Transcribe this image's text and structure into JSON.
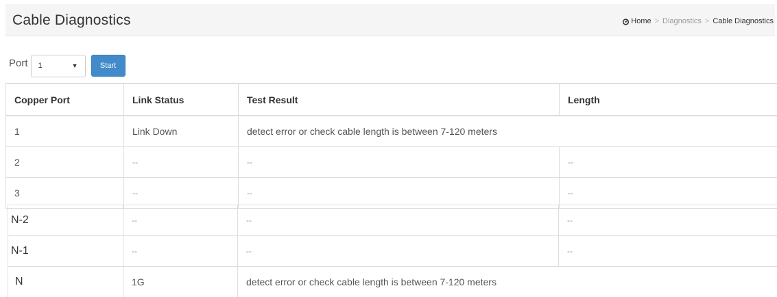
{
  "header": {
    "title": "Cable Diagnostics",
    "breadcrumb": {
      "home": "Home",
      "section": "Diagnostics",
      "current": "Cable Diagnostics",
      "separator": ">"
    }
  },
  "toolbar": {
    "port_label": "Port",
    "port_value": "1",
    "start_label": "Start"
  },
  "table": {
    "headers": {
      "copper_port": "Copper Port",
      "link_status": "Link Status",
      "test_result": "Test Result",
      "length": "Length"
    },
    "rows_top": [
      {
        "port": "1",
        "link_status": "Link Down",
        "test_result": "detect error or check cable length is between 7-120 meters",
        "length": ""
      },
      {
        "port": "2",
        "link_status": "--",
        "test_result": "--",
        "length": "--"
      },
      {
        "port": "3",
        "link_status": "--",
        "test_result": "--",
        "length": "--"
      }
    ],
    "rows_bottom": [
      {
        "port": "N-2",
        "link_status": "--",
        "test_result": "--",
        "length": "--"
      },
      {
        "port": "N-1",
        "link_status": "--",
        "test_result": "--",
        "length": "--"
      },
      {
        "port": "N",
        "link_status": "1G",
        "test_result": "detect error or check cable length is between 7-120 meters",
        "length": ""
      }
    ]
  }
}
